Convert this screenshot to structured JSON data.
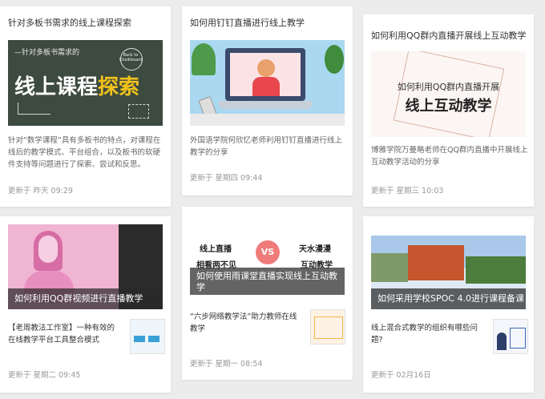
{
  "cards": [
    {
      "title": "针对多板书需求的线上课程探索",
      "thumb_small_text": "—针对多板书需求的",
      "thumb_big_text": "线上课程",
      "thumb_highlight_text": "探索",
      "thumb_badge_text": "Back to Chalkboard",
      "description": "针对“数学课程”具有多板书的特点，对课程在线后的教学模式、平台组合，以及板书的软硬件支持等问题进行了探索、尝试和反思。",
      "updated": "更新于 昨天 09:29"
    },
    {
      "title": "如何用钉钉直播进行线上教学",
      "description": "外国语学院何欣忆老师利用钉钉直播进行线上教学的分享",
      "updated": "更新于 星期四 09:44"
    },
    {
      "title": "如何利用QQ群内直播开展线上互动教学",
      "thumb_line1": "如何利用QQ群内直播开展",
      "thumb_line2": "线上互动教学",
      "description": "博雅学院万曼略老师在QQ群内直播中开展线上互动教学活动的分享",
      "updated": "更新于 星期三 10:03"
    },
    {
      "caption": "如何利用QQ群视频进行直播教学",
      "row_text": "【老周教法工作室】一种有效的在线教学平台工具整合模式",
      "updated": "更新于 星期二 09:45"
    },
    {
      "caption": "如何使用雨课堂直播实现线上互动教学",
      "thumb_left_line1": "线上直播",
      "thumb_left_line2": "相看两不见",
      "thumb_vs": "VS",
      "thumb_right_line1": "天水漫漫",
      "thumb_right_line2": "互动教学",
      "row_text": "“六步网络教学法”助力教师在线教学",
      "updated": "更新于 星期一 08:54"
    },
    {
      "caption": "如何采用学校SPOC 4.0进行课程备课",
      "row_text": "线上混合式教学的组织有哪些问题?",
      "updated": "更新于 02月16日"
    }
  ],
  "colors": {
    "chalkboard": "#3d4a3f",
    "chalk_yellow": "#f2c21b",
    "dingtalk_bg": "#aad8f0",
    "card_bg": "#ffffff",
    "page_bg": "#ececec"
  }
}
